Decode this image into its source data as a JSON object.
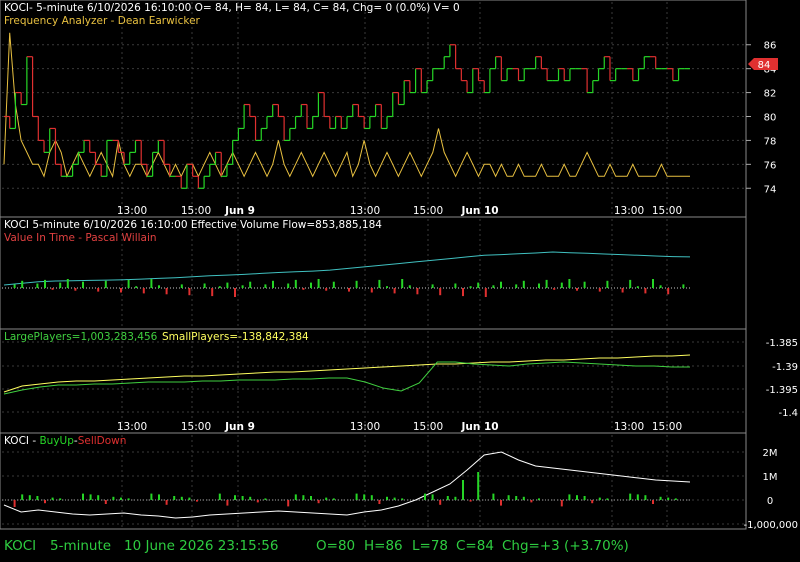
{
  "chart_data": {
    "type": "line",
    "symbol": "KOCI",
    "interval": "5-minute",
    "panels": [
      {
        "id": "price",
        "header_line1": "KOCI- 5-minute 6/10/2026 16:10:00 O= 84, H= 84, L= 84, C= 84, Chg= 0 (0.0%) V= 0",
        "header_line2": "Frequency Analyzer - Dean Earwicker",
        "y_ticks": [
          "86",
          "84",
          "82",
          "80",
          "78",
          "76",
          "74"
        ],
        "y_tick_values": [
          86,
          84,
          82,
          80,
          78,
          76,
          74
        ],
        "ylim": [
          72.6,
          87.4
        ],
        "last_price_label": "84",
        "last_price": 84,
        "x_tick_labels": [
          "13:00",
          "15:00",
          "Jun 9",
          "13:00",
          "15:00",
          "Jun 10",
          "13:00",
          "15:00"
        ],
        "series": {
          "close": [
            80,
            79,
            82,
            81,
            85,
            80,
            78,
            77,
            79,
            76,
            75,
            75,
            76,
            77,
            78,
            77,
            76,
            75,
            78,
            78,
            77,
            76,
            77,
            78,
            76,
            75,
            77,
            78,
            76,
            75,
            75,
            74,
            76,
            75,
            74,
            75,
            76,
            77,
            75,
            76,
            78,
            79,
            81,
            80,
            78,
            79,
            80,
            81,
            80,
            78,
            79,
            80,
            81,
            79,
            80,
            82,
            80,
            79,
            80,
            79,
            80,
            81,
            80,
            79,
            80,
            81,
            79,
            80,
            82,
            81,
            83,
            82,
            84,
            82,
            83,
            84,
            84,
            85,
            86,
            84,
            83,
            82,
            84,
            83,
            82,
            84,
            85,
            83,
            84,
            84,
            83,
            84,
            84,
            85,
            84,
            83,
            83,
            84,
            83,
            84,
            84,
            84,
            82,
            83,
            84,
            85,
            83,
            84,
            84,
            84,
            83,
            84,
            85,
            85,
            84,
            84,
            84,
            83,
            84,
            84,
            84
          ],
          "frequency_analyzer": [
            76,
            87,
            81,
            78,
            77,
            76,
            76,
            75,
            77,
            78,
            77,
            75,
            76,
            77,
            76,
            75,
            76,
            77,
            76,
            75,
            78,
            76,
            75,
            76,
            76,
            75,
            76,
            77,
            76,
            75,
            76,
            75,
            76,
            76,
            75,
            76,
            77,
            76,
            75,
            76,
            77,
            76,
            75,
            76,
            77,
            76,
            75,
            76,
            78,
            76,
            75,
            76,
            77,
            76,
            75,
            76,
            77,
            76,
            75,
            76,
            77,
            75,
            76,
            78,
            76,
            75,
            76,
            77,
            76,
            75,
            76,
            77,
            76,
            75,
            76,
            77,
            79,
            77,
            76,
            75,
            76,
            77,
            76,
            75,
            76,
            76,
            75,
            76,
            75,
            75,
            76,
            75,
            75,
            75,
            76,
            75,
            75,
            75,
            76,
            75,
            75,
            76,
            77,
            76,
            75,
            75,
            76,
            75,
            75,
            75,
            76,
            75,
            75,
            75,
            75,
            76,
            75,
            75,
            75,
            75,
            75
          ]
        }
      },
      {
        "id": "volume-flow",
        "header_line1": "KOCI 5-minute  6/10/2026 16:10:00  Effective Volume Flow=853,885,184",
        "header_line2": "Value In Time - Pascal Willain",
        "series": {
          "effective_volume_flow_rel": [
            0,
            0.05,
            0.1,
            0.12,
            0.13,
            0.14,
            0.15,
            0.16,
            0.18,
            0.2,
            0.22,
            0.25,
            0.28,
            0.3,
            0.32,
            0.35,
            0.38,
            0.4,
            0.42,
            0.45,
            0.5,
            0.55,
            0.6,
            0.65,
            0.7,
            0.75,
            0.8,
            0.85,
            0.9,
            0.92,
            0.95,
            0.97,
            1.0,
            0.98,
            0.96,
            0.94,
            0.92,
            0.9,
            0.88,
            0.86,
            0.85
          ]
        }
      },
      {
        "id": "players",
        "header_large": "LargePlayers=1,003,283,456",
        "header_small": "SmallPlayers=-138,842,384",
        "y_ticks": [
          "-1.385",
          "-1.39",
          "-1.395",
          "-1.4"
        ],
        "x_tick_labels": [
          "13:00",
          "15:00",
          "Jun 9",
          "13:00",
          "15:00",
          "Jun 10",
          "13:00",
          "15:00"
        ]
      },
      {
        "id": "buyup-selldown",
        "header_prefix": "KOCI - ",
        "header_buy": "BuyUp",
        "header_sep": "-",
        "header_sell": "SellDown",
        "y_ticks": [
          "2M",
          "1M",
          "0",
          "-1,000,000"
        ],
        "y_tick_values": [
          2000000,
          1000000,
          0,
          -1000000
        ]
      }
    ],
    "colors": {
      "bull": "#26d626",
      "bear": "#e03030",
      "freq": "#e8c040",
      "flow": "#40c0c0",
      "large": "#ffff60",
      "small": "#40d040",
      "label_red": "#e04040",
      "header_white": "#ffffff"
    }
  },
  "statusbar": {
    "symbol": "KOCI",
    "interval": "5-minute",
    "datetime": "10 June 2026 23:15:56",
    "open": "O=80",
    "high": "H=86",
    "low": "L=78",
    "close": "C=84",
    "change": "Chg=+3 (+3.70%)"
  }
}
